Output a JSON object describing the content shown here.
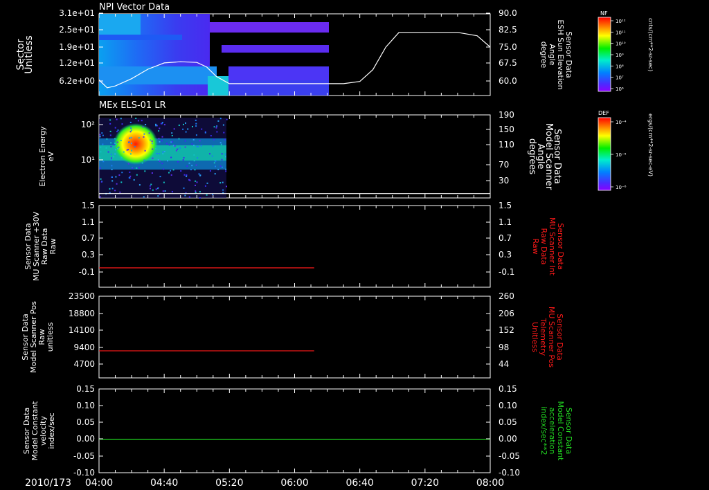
{
  "colors": {
    "background": "#000000",
    "axis": "#ffffff",
    "text": "#ffffff",
    "red_series": "#ff1a1a",
    "green_series": "#22dd22",
    "elevation_line": "#ffffff"
  },
  "date_label": "2010/173",
  "x_axis": {
    "range": [
      "04:00",
      "08:00"
    ],
    "tick_labels": [
      "04:00",
      "04:40",
      "05:20",
      "06:00",
      "06:40",
      "07:20",
      "08:00"
    ]
  },
  "chart_data": [
    {
      "type": "heatmap",
      "title": "NPI Vector Data",
      "ylabel": [
        "Sector",
        "Unitless"
      ],
      "y_tick_labels": [
        "3.1e+01",
        "2.5e+01",
        "1.9e+01",
        "1.2e+01",
        "6.2e+00"
      ],
      "data_extent_x": [
        "04:00",
        "06:10"
      ],
      "overlay_series": {
        "type": "line",
        "ylabel": [
          "Sensor Data",
          "ESH Sun Elevation",
          "Angle",
          "degree"
        ],
        "y_tick_labels": [
          "90.0",
          "82.5",
          "75.0",
          "67.5",
          "60.0"
        ],
        "ylim": [
          55,
          90
        ],
        "x": [
          "04:00",
          "04:05",
          "04:10",
          "04:20",
          "04:30",
          "04:40",
          "04:50",
          "05:00",
          "05:06",
          "05:12",
          "05:20",
          "05:40",
          "06:00",
          "06:20",
          "06:30",
          "06:40",
          "06:48",
          "06:56",
          "07:04",
          "07:20",
          "07:40",
          "07:52",
          "08:00"
        ],
        "values": [
          60.5,
          57.0,
          57.8,
          61.0,
          65.2,
          68.0,
          68.5,
          68.2,
          66.2,
          62.0,
          58.8,
          58.8,
          58.8,
          58.8,
          58.8,
          59.8,
          65.0,
          75.0,
          81.5,
          81.5,
          81.5,
          80.0,
          75.0
        ]
      },
      "colorbar": {
        "label": "NF",
        "units": "cnts/(cm**2-sr-sec)",
        "tick_labels": [
          "10¹²",
          "10¹¹",
          "10¹⁰",
          "10⁹",
          "10⁸",
          "10⁷",
          "10⁶"
        ]
      }
    },
    {
      "type": "heatmap",
      "title": "MEx ELS-01 LR",
      "ylabel": [
        "Electron Energy",
        "eV"
      ],
      "y_tick_labels": [
        "10²",
        "10¹"
      ],
      "data_extent_x": [
        "04:00",
        "05:20"
      ],
      "overlay_series": {
        "type": "line",
        "ylabel": [
          "Sensor Data",
          "Model Scanner",
          "Angle",
          "degrees"
        ],
        "y_tick_labels": [
          "190",
          "150",
          "110",
          "70",
          "30"
        ],
        "ylim": [
          0,
          190
        ],
        "x": [
          "04:00",
          "08:00"
        ],
        "values": [
          10,
          10
        ]
      },
      "colorbar": {
        "label": "DEF",
        "units": "ergs/(cm**2-sr-sec-eV)",
        "tick_labels": [
          "10⁻⁴",
          "10⁻⁵",
          "10⁻⁶"
        ]
      }
    },
    {
      "type": "line",
      "ylabel": [
        "Sensor Data",
        "MU Scanner +30V",
        "Raw Data",
        "Raw"
      ],
      "y_tick_labels": [
        "1.5",
        "1.1",
        "0.7",
        "0.3",
        "-0.1"
      ],
      "ylim": [
        -0.3,
        1.5
      ],
      "right_ylabel": [
        "Sensor Data",
        "MU Scanner Int",
        "Raw Data",
        "Raw"
      ],
      "right_y_tick_labels": [
        "1.5",
        "1.1",
        "0.7",
        "0.3",
        "-0.1"
      ],
      "series": [
        {
          "name": "Sensor Data MU Scanner Int Raw Data",
          "x": [
            "04:00",
            "06:12"
          ],
          "values": [
            0,
            0
          ]
        }
      ]
    },
    {
      "type": "line",
      "ylabel": [
        "Sensor Data",
        "Model Scanner Pos",
        "Raw",
        "unitless"
      ],
      "y_tick_labels": [
        "23500",
        "18800",
        "14100",
        "9400",
        "4700"
      ],
      "ylim": [
        0,
        23500
      ],
      "right_ylabel": [
        "Sensor Data",
        "MU Scanner Pos",
        "Telemetry",
        "Unitless"
      ],
      "right_y_tick_labels": [
        "260",
        "206",
        "152",
        "98",
        "44"
      ],
      "right_ylim": [
        0,
        260
      ],
      "series": [
        {
          "name": "Sensor Data MU Scanner Pos Telemetry",
          "x": [
            "04:00",
            "06:12"
          ],
          "values": [
            86,
            86
          ]
        }
      ]
    },
    {
      "type": "line",
      "ylabel": [
        "Sensor Data",
        "Model Constant",
        "velocity",
        "index/sec"
      ],
      "y_tick_labels": [
        "0.15",
        "0.10",
        "0.05",
        "0.00",
        "-0.05",
        "-0.10"
      ],
      "ylim": [
        -0.1,
        0.15
      ],
      "right_ylabel": [
        "Sensor Data",
        "Model Constant",
        "acceleration",
        "index/sec**2"
      ],
      "right_y_tick_labels": [
        "0.15",
        "0.10",
        "0.05",
        "0.00",
        "-0.05",
        "-0.10"
      ],
      "series": [
        {
          "name": "Sensor Data Model Constant acceleration",
          "x": [
            "04:00",
            "08:00"
          ],
          "values": [
            0,
            0
          ]
        }
      ]
    }
  ]
}
